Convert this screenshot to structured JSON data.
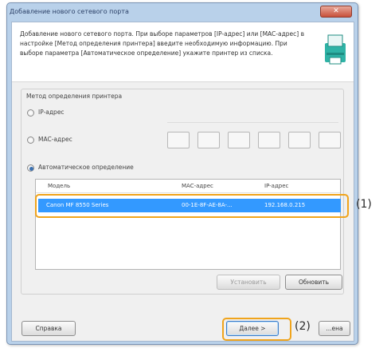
{
  "window": {
    "title": "Добавление нового сетевого порта",
    "close_glyph": "✕"
  },
  "header": {
    "description": "Добавление нового сетевого порта. При выборе параметров [IP-адрес] или [MAC-адрес] в настройке [Метод определения принтера] введите необходимую информацию. При выборе параметра [Автоматическое определение] укажите принтер из списка.",
    "icon": "printer-icon"
  },
  "method": {
    "group_title": "Метод определения принтера",
    "options": [
      {
        "label": "IP-адрес",
        "selected": false
      },
      {
        "label": "MAC-адрес",
        "selected": false
      },
      {
        "label": "Автоматическое определение",
        "selected": true
      }
    ]
  },
  "table": {
    "columns": [
      "Модель",
      "MAC-адрес",
      "IP-адрес"
    ],
    "rows": [
      {
        "model": "Canon MF 8550 Series",
        "mac": "00-1E-8F-AE-8A-...",
        "ip": "192.168.0.215"
      }
    ]
  },
  "buttons": {
    "set": "Установить",
    "refresh": "Обновить",
    "help": "Справка",
    "next": "Далее >",
    "cancel": "...ена"
  },
  "callouts": {
    "one": "(1)",
    "two": "(2)"
  },
  "colors": {
    "selection": "#3399ff",
    "callout": "#f0a41c"
  }
}
